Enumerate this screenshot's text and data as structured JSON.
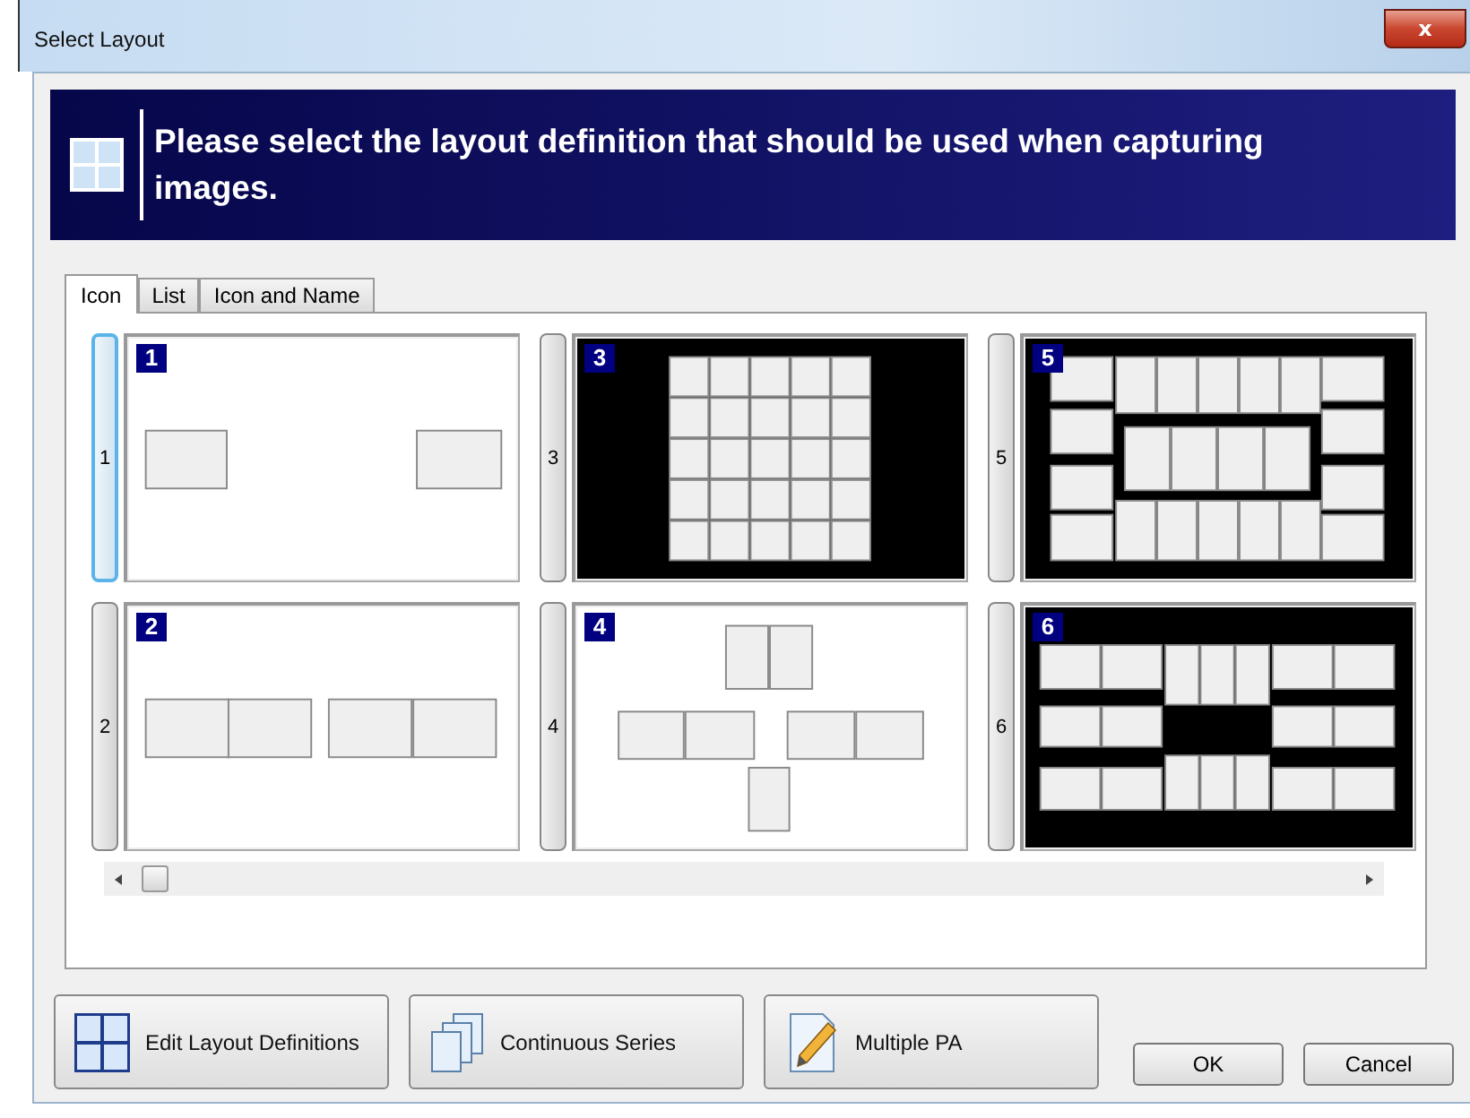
{
  "window": {
    "title": "Select Layout",
    "close": "x"
  },
  "banner": {
    "message": "Please select the layout definition that should be used when capturing images."
  },
  "tabs": [
    {
      "label": "Icon",
      "selected": true
    },
    {
      "label": "List",
      "selected": false
    },
    {
      "label": "Icon and Name",
      "selected": false
    }
  ],
  "layouts": [
    {
      "tab_label": "1",
      "badge": "1",
      "selected": true,
      "dark": false,
      "kind": "pair"
    },
    {
      "tab_label": "2",
      "badge": "2",
      "selected": false,
      "dark": false,
      "kind": "quad"
    },
    {
      "tab_label": "3",
      "badge": "3",
      "selected": false,
      "dark": true,
      "kind": "grid"
    },
    {
      "tab_label": "4",
      "badge": "4",
      "selected": false,
      "dark": false,
      "kind": "cross"
    },
    {
      "tab_label": "5",
      "badge": "5",
      "selected": false,
      "dark": true,
      "kind": "ring"
    },
    {
      "tab_label": "6",
      "badge": "6",
      "selected": false,
      "dark": true,
      "kind": "bands"
    }
  ],
  "actions": [
    {
      "label": "Edit Layout Definitions",
      "kind": "grid"
    },
    {
      "label": "Continuous Series",
      "kind": "pages"
    },
    {
      "label": "Multiple PA",
      "kind": "pencil"
    }
  ],
  "buttons": [
    "OK",
    "Cancel"
  ]
}
